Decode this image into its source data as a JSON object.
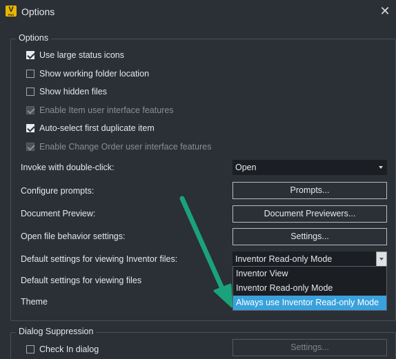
{
  "window": {
    "title": "Options",
    "app_icon_letter": "V",
    "app_icon_sub": "PRO",
    "close_glyph": "✕"
  },
  "options_group": {
    "legend": "Options",
    "checkboxes": [
      {
        "label": "Use large status icons",
        "checked": true,
        "enabled": true
      },
      {
        "label": "Show working folder location",
        "checked": false,
        "enabled": true
      },
      {
        "label": "Show hidden files",
        "checked": false,
        "enabled": true
      },
      {
        "label": "Enable Item user interface features",
        "checked": true,
        "enabled": false
      },
      {
        "label": "Auto-select first duplicate item",
        "checked": true,
        "enabled": true
      },
      {
        "label": "Enable Change Order user interface features",
        "checked": true,
        "enabled": false
      }
    ],
    "invoke": {
      "label": "Invoke with double-click:",
      "value": "Open"
    },
    "configure_prompts": {
      "label": "Configure prompts:",
      "button": "Prompts..."
    },
    "document_preview": {
      "label": "Document Preview:",
      "button": "Document Previewers..."
    },
    "open_file_behavior": {
      "label": "Open file behavior settings:",
      "button": "Settings..."
    },
    "inventor_viewing": {
      "label": "Default settings for viewing Inventor files:",
      "value": "Inventor Read-only Mode",
      "options": [
        "Inventor View",
        "Inventor Read-only Mode",
        "Always use Inventor Read-only Mode"
      ],
      "highlighted_index": 2
    },
    "viewing_files": {
      "label": "Default settings for viewing files"
    },
    "theme": {
      "label": "Theme"
    }
  },
  "dialog_suppression": {
    "legend": "Dialog Suppression",
    "checkin": {
      "label": "Check In dialog",
      "checked": false
    },
    "button": "Settings..."
  },
  "colors": {
    "background": "#2b2f36",
    "highlight": "#3aa1dc",
    "annotation_arrow": "#1aa37a"
  }
}
